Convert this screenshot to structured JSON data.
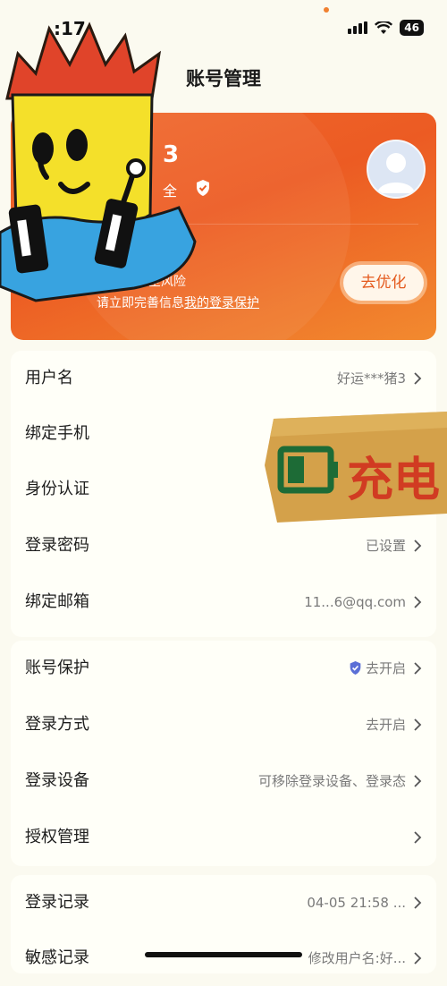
{
  "status_bar": {
    "time": ":17",
    "battery": "46"
  },
  "header": {
    "title": "账号管理"
  },
  "profile": {
    "name": "3",
    "safety_label": "全",
    "risk_text": "存在安全风险",
    "risk_sub_prefix": "请立即完善信息",
    "risk_sub_link": "我的登录保护",
    "optimize_button": "去优化"
  },
  "section1": {
    "rows": [
      {
        "label": "用户名",
        "value": "好运***猪3"
      },
      {
        "label": "绑定手机",
        "value": ""
      },
      {
        "label": "身份认证",
        "value": ""
      },
      {
        "label": "登录密码",
        "value": "已设置"
      },
      {
        "label": "绑定邮箱",
        "value": "11...6@qq.com"
      }
    ]
  },
  "section2": {
    "rows": [
      {
        "label": "账号保护",
        "value": "去开启"
      },
      {
        "label": "登录方式",
        "value": "去开启"
      },
      {
        "label": "登录设备",
        "value": "可移除登录设备、登录态"
      },
      {
        "label": "授权管理",
        "value": ""
      }
    ]
  },
  "section3": {
    "rows": [
      {
        "label": "登录记录",
        "value": "04-05 21:58 ..."
      },
      {
        "label": "敏感记录",
        "value": "修改用户名:好..."
      }
    ]
  },
  "sticker": {
    "charge_text": "充电"
  },
  "colors": {
    "accent": "#ec5b23",
    "background": "#fbfaf0"
  }
}
